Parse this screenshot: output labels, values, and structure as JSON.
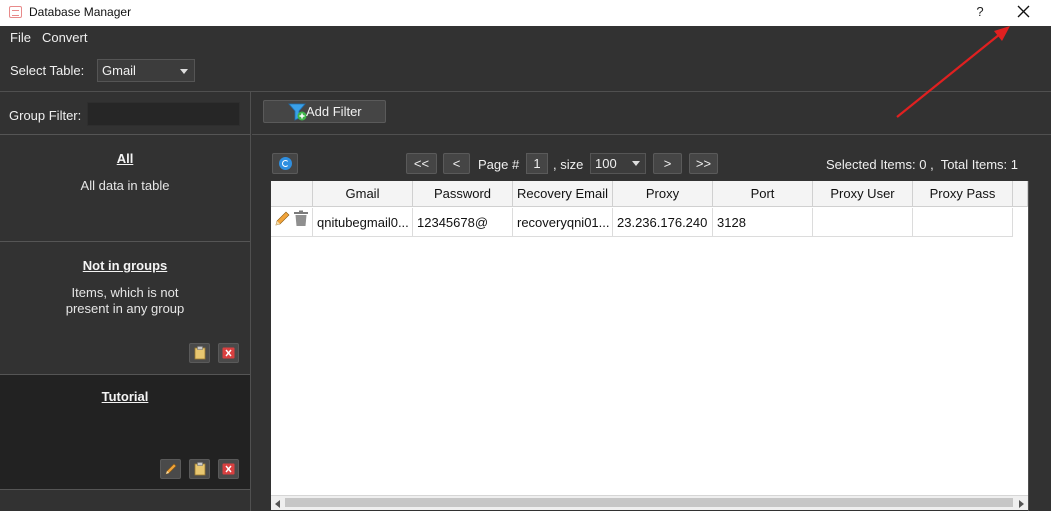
{
  "window": {
    "title": "Database Manager",
    "help_label": "?",
    "close_icon": "close-icon"
  },
  "menu": {
    "items": [
      {
        "label": "File"
      },
      {
        "label": "Convert"
      }
    ]
  },
  "table_select": {
    "label": "Select Table:",
    "value": "Gmail"
  },
  "group_filter": {
    "label": "Group Filter:",
    "value": ""
  },
  "groups": [
    {
      "title": "All",
      "description": "All data in table"
    },
    {
      "title": "Not in groups",
      "description_line1": "Items, which is not",
      "description_line2": "present in any group"
    },
    {
      "title": "Tutorial"
    }
  ],
  "toolbar": {
    "add_filter_label": "Add Filter"
  },
  "pagination": {
    "first_label": "<<",
    "prev_label": "<",
    "page_label": "Page #",
    "page_value": "1",
    "size_label": ", size",
    "size_value": "100",
    "next_label": ">",
    "last_label": ">>",
    "selected_label": "Selected Items:",
    "selected_value": "0",
    "total_label": "Total Items:",
    "total_value": "1"
  },
  "grid": {
    "columns": [
      "Gmail",
      "Password",
      "Recovery Email",
      "Proxy",
      "Port",
      "Proxy User",
      "Proxy Pass"
    ],
    "rows": [
      [
        "qnitubegmail0...",
        "12345678@",
        "recoveryqni01...",
        "23.236.176.240",
        "3128",
        "",
        ""
      ]
    ]
  },
  "colors": {
    "background": "#323232",
    "title_bar": "#ffffff",
    "selected_group": "#222222",
    "refresh_icon": "#2f8fe0",
    "annotation_arrow": "#e02020"
  }
}
